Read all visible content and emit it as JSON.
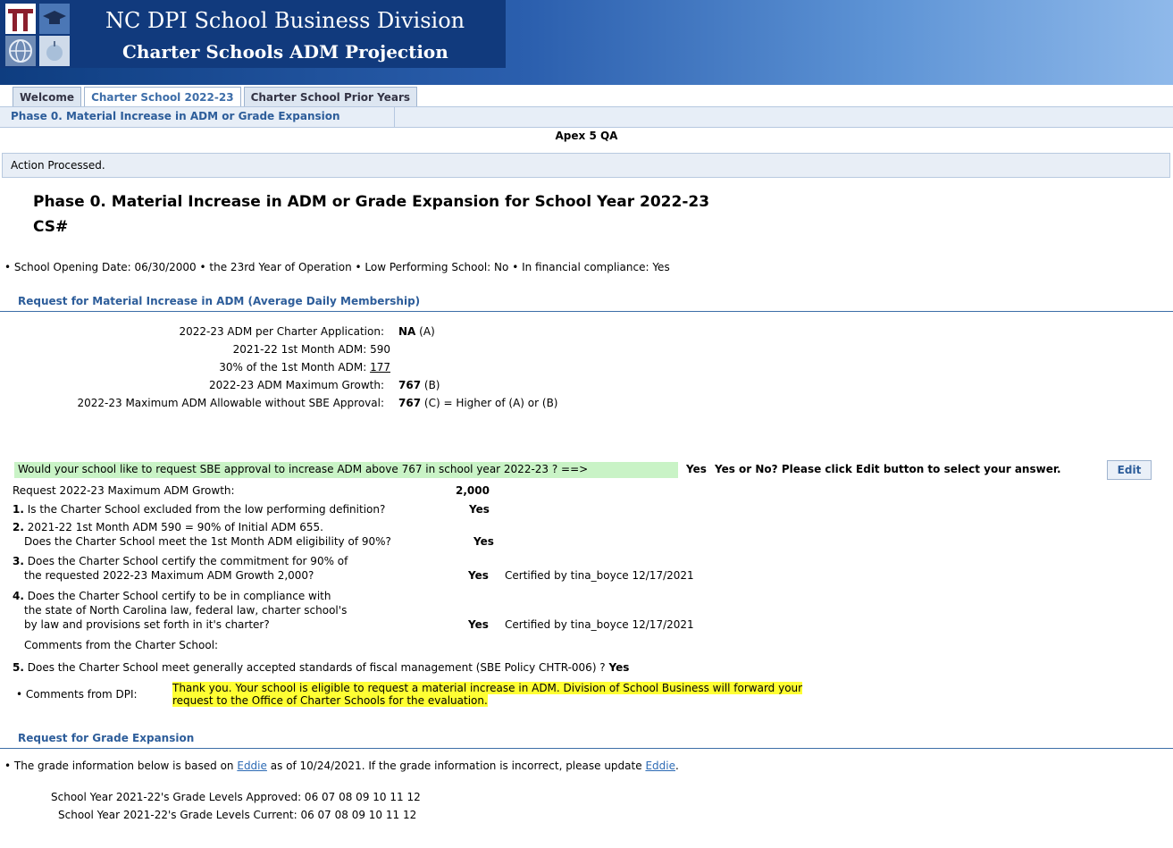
{
  "header": {
    "title": "NC DPI School Business Division",
    "subtitle": "Charter Schools ADM Projection"
  },
  "tabs": [
    "Welcome",
    "Charter School 2022-23",
    "Charter School Prior Years"
  ],
  "subnav": {
    "item": "Phase 0. Material Increase in ADM or Grade Expansion"
  },
  "environment": "Apex 5 QA",
  "message": "Action Processed.",
  "page": {
    "title": "Phase 0. Material Increase in ADM or Grade Expansion for School Year 2022-23",
    "subtitle": "CS#"
  },
  "school_info": {
    "opening": "School Opening Date: 06/30/2000",
    "year_op": "the 23rd Year of Operation",
    "low_perf": "Low Performing School: No",
    "compliance": "In financial compliance: Yes"
  },
  "adm_section": {
    "heading": "Request for Material Increase in ADM (Average Daily Membership)",
    "rows": {
      "app_label": "2022-23 ADM per Charter Application:",
      "app_value": "NA",
      "app_suffix": "(A)",
      "first_month": "2021-22 1st Month ADM: 590",
      "pct_label": "30% of the 1st Month ADM:",
      "pct_value": "177",
      "max_growth_label": "2022-23 ADM Maximum Growth:",
      "max_growth_value": "767",
      "max_growth_suffix": "(B)",
      "max_allow_label": "2022-23 Maximum ADM Allowable without SBE Approval:",
      "max_allow_value": "767",
      "max_allow_suffix": "(C) = Higher of (A) or (B)"
    }
  },
  "question": {
    "text": "Would your school like to request SBE approval to increase ADM above 767 in school year 2022-23 ? ==>",
    "answer": "Yes",
    "prompt": "Yes or No? Please click Edit button to select your answer.",
    "edit_label": "Edit"
  },
  "request": {
    "label": "Request 2022-23 Maximum ADM Growth:",
    "value": "2,000"
  },
  "criteria": {
    "q1_num": "1.",
    "q1_text": "Is the Charter School excluded from the low performing definition?",
    "q1_ans": "Yes",
    "q2_num": "2.",
    "q2_line1": "2021-22 1st Month ADM 590 = 90% of Initial ADM 655.",
    "q2_line2": "Does the Charter School meet the 1st Month ADM eligibility of 90%?",
    "q2_ans": "Yes",
    "q3_num": "3.",
    "q3_line1": "Does the Charter School certify the commitment for 90% of",
    "q3_line2": "the requested 2022-23 Maximum ADM Growth 2,000?",
    "q3_ans": "Yes",
    "q3_cert": "Certified by tina_boyce 12/17/2021",
    "q4_num": "4.",
    "q4_line1": "Does the Charter School certify to be in compliance with",
    "q4_line2": "the state of North Carolina law, federal law, charter school's",
    "q4_line3": "by law and provisions set forth in it's charter?",
    "q4_ans": "Yes",
    "q4_cert": "Certified by tina_boyce 12/17/2021",
    "comments_school": "Comments from the Charter School:",
    "q5_num": "5.",
    "q5_text": "Does the Charter School meet generally accepted standards of fiscal management (SBE Policy CHTR-006) ?",
    "q5_ans": "Yes"
  },
  "dpi_comments": {
    "label": "Comments from DPI:",
    "line1": "Thank you. Your school is eligible to request a material increase in ADM. Division of School Business will forward your",
    "line2": "request to the Office of Charter Schools for the evaluation."
  },
  "grade_section": {
    "heading": "Request for Grade Expansion",
    "note_pre": "The grade information below is based on",
    "link1": "Eddie",
    "note_mid": "as of 10/24/2021. If the grade information is incorrect, please update",
    "link2": "Eddie",
    "note_end": ".",
    "approved": "School Year 2021-22's Grade Levels Approved: 06 07 08 09 10 11 12",
    "current": "School Year 2021-22's Grade Levels Current: 06 07 08 09 10 11 12"
  },
  "colors": {
    "header_blue": "#113a7d",
    "link_blue": "#2d6bb5",
    "question_green": "#c9f3c6",
    "highlight_yellow": "#ffff33"
  }
}
